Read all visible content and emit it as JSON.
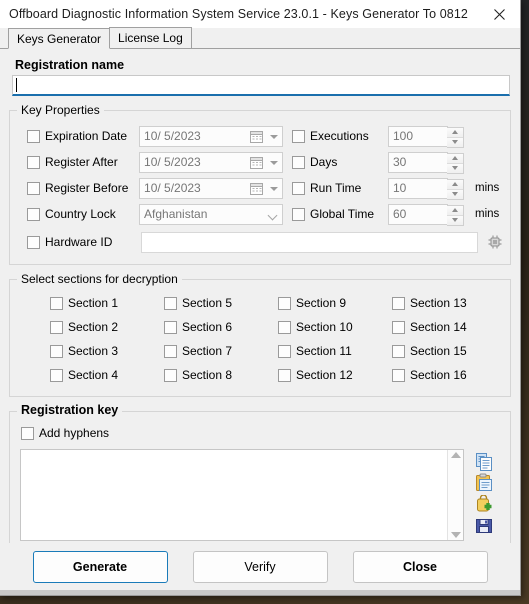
{
  "window": {
    "title": "Offboard Diagnostic Information System Service 23.0.1 - Keys Generator To 0812",
    "close_label": "✕",
    "accent": "#1a7bb9"
  },
  "tabs": [
    {
      "label": "Keys Generator",
      "active": true
    },
    {
      "label": "License Log",
      "active": false
    }
  ],
  "registration_name": {
    "heading": "Registration name",
    "value": "",
    "placeholder": ""
  },
  "key_properties": {
    "legend": "Key Properties",
    "left_rows": [
      {
        "label": "Expiration Date",
        "checked": false,
        "control": "date",
        "value": "10/  5/2023"
      },
      {
        "label": "Register After",
        "checked": false,
        "control": "date",
        "value": "10/  5/2023"
      },
      {
        "label": "Register Before",
        "checked": false,
        "control": "date",
        "value": "10/  5/2023"
      },
      {
        "label": "Country Lock",
        "checked": false,
        "control": "combo",
        "value": "Afghanistan"
      }
    ],
    "right_rows": [
      {
        "label": "Executions",
        "checked": false,
        "control": "spin",
        "value": "100",
        "suffix": ""
      },
      {
        "label": "Days",
        "checked": false,
        "control": "spin",
        "value": "30",
        "suffix": ""
      },
      {
        "label": "Run Time",
        "checked": false,
        "control": "spin",
        "value": "10",
        "suffix": "mins"
      },
      {
        "label": "Global Time",
        "checked": false,
        "control": "spin",
        "value": "60",
        "suffix": "mins"
      }
    ],
    "hardware_id": {
      "label": "Hardware ID",
      "checked": false,
      "value": ""
    }
  },
  "sections": {
    "legend": "Select sections for decryption",
    "items": [
      {
        "label": "Section 1",
        "checked": false
      },
      {
        "label": "Section 2",
        "checked": false
      },
      {
        "label": "Section 3",
        "checked": false
      },
      {
        "label": "Section 4",
        "checked": false
      },
      {
        "label": "Section 5",
        "checked": false
      },
      {
        "label": "Section 6",
        "checked": false
      },
      {
        "label": "Section 7",
        "checked": false
      },
      {
        "label": "Section 8",
        "checked": false
      },
      {
        "label": "Section 9",
        "checked": false
      },
      {
        "label": "Section 10",
        "checked": false
      },
      {
        "label": "Section 11",
        "checked": false
      },
      {
        "label": "Section 12",
        "checked": false
      },
      {
        "label": "Section 13",
        "checked": false
      },
      {
        "label": "Section 14",
        "checked": false
      },
      {
        "label": "Section 15",
        "checked": false
      },
      {
        "label": "Section 16",
        "checked": false
      }
    ]
  },
  "registration_key": {
    "legend": "Registration key",
    "add_hyphens_label": "Add hyphens",
    "add_hyphens_checked": false,
    "value": "",
    "tools": [
      {
        "name": "copy-icon"
      },
      {
        "name": "paste-icon"
      },
      {
        "name": "add-key-icon"
      },
      {
        "name": "save-icon"
      }
    ]
  },
  "footer": {
    "generate_label": "Generate",
    "verify_label": "Verify",
    "close_label": "Close"
  }
}
